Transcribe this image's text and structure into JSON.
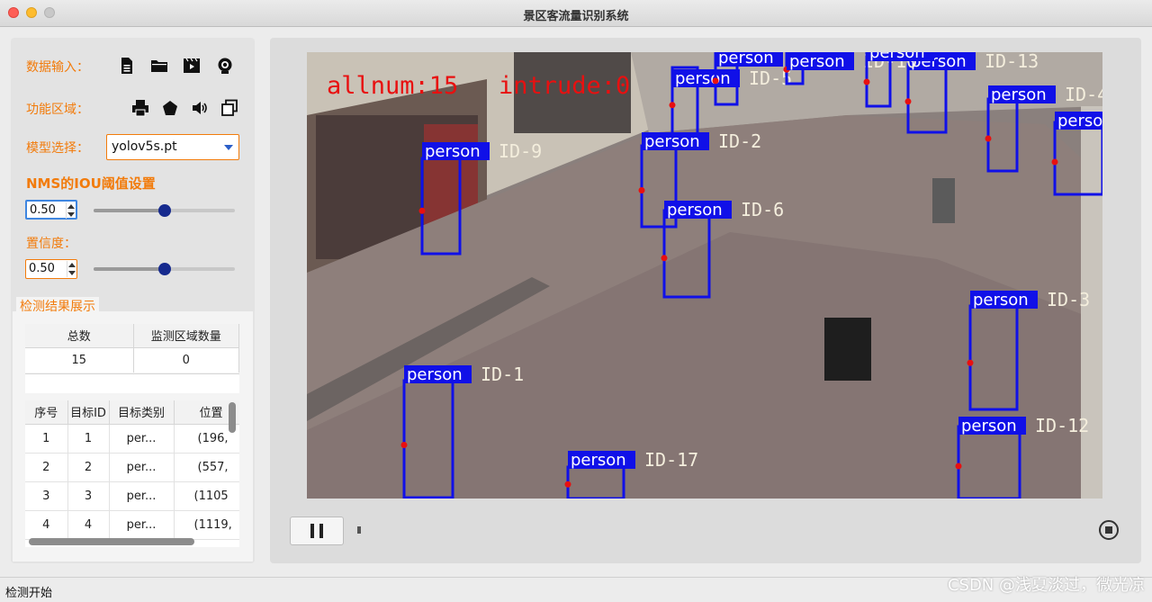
{
  "window": {
    "title": "景区客流量识别系统"
  },
  "left": {
    "data_input_label": "数据输入：",
    "function_area_label": "功能区域：",
    "model_label": "模型选择：",
    "model_value": "yolov5s.pt",
    "iou_label": "NMS的IOU阈值设置",
    "iou_value": "0.50",
    "iou_level": 0.5,
    "conf_label": "置信度：",
    "conf_value": "0.50",
    "conf_level": 0.5,
    "data_input_icons": [
      "file-icon",
      "folder-icon",
      "video-icon",
      "camera-icon"
    ],
    "function_icons": [
      "printer-icon",
      "pentagon-icon",
      "speaker-icon",
      "copy-icon"
    ]
  },
  "results": {
    "group_title": "检测结果展示",
    "summary_headers": [
      "总数",
      "监测区域数量"
    ],
    "summary_values": [
      "15",
      "0"
    ],
    "detail_headers": [
      "序号",
      "目标ID",
      "目标类别",
      "位置"
    ],
    "rows": [
      [
        "1",
        "1",
        "per...",
        "(196,"
      ],
      [
        "2",
        "2",
        "per...",
        "(557,"
      ],
      [
        "3",
        "3",
        "per...",
        "(1105"
      ],
      [
        "4",
        "4",
        "per...",
        "(1119,"
      ]
    ]
  },
  "video": {
    "overlay": {
      "allnum": "allnum:15",
      "intrude": "intrude:0"
    },
    "detections": [
      {
        "label": "person",
        "id": "ID-9"
      },
      {
        "label": "person",
        "id": "ID-5"
      },
      {
        "label": "person",
        "id": "ID-2"
      },
      {
        "label": "person",
        "id": "ID-6"
      },
      {
        "label": "person",
        "id": "ID-1"
      },
      {
        "label": "person",
        "id": "ID-17"
      },
      {
        "label": "person",
        "id": "ID-3"
      },
      {
        "label": "person",
        "id": "ID-12"
      },
      {
        "label": "person",
        "id": "ID-13"
      },
      {
        "label": "person",
        "id": "ID-10"
      },
      {
        "label": "person",
        "id": "ID-4"
      },
      {
        "label": "person",
        "id": ""
      },
      {
        "label": "person",
        "id": ""
      },
      {
        "label": "person",
        "id": ""
      }
    ]
  },
  "status": {
    "text": "检测开始"
  },
  "watermark": "CSDN @浅夏淡过，微光凉",
  "colors": {
    "accent": "#f27b0b",
    "box": "#1010e8",
    "overlay_text": "#e81010"
  }
}
